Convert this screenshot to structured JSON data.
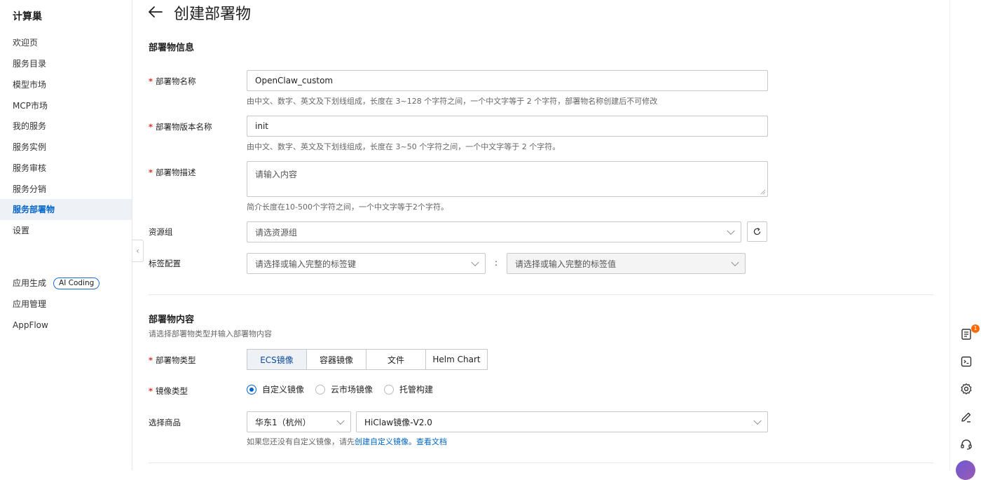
{
  "sidebar": {
    "brand": "计算巢",
    "items": [
      {
        "label": "欢迎页"
      },
      {
        "label": "服务目录"
      },
      {
        "label": "模型市场"
      },
      {
        "label": "MCP市场"
      },
      {
        "label": "我的服务"
      },
      {
        "label": "服务实例"
      },
      {
        "label": "服务审核"
      },
      {
        "label": "服务分销"
      },
      {
        "label": "服务部署物",
        "active": true
      },
      {
        "label": "设置"
      }
    ],
    "bottom_items": [
      {
        "label": "应用生成",
        "badge": "AI Coding"
      },
      {
        "label": "应用管理"
      },
      {
        "label": "AppFlow"
      }
    ]
  },
  "header": {
    "title": "创建部署物"
  },
  "section_info": {
    "title": "部署物信息",
    "name": {
      "label": "部署物名称",
      "value": "OpenClaw_custom",
      "help": "由中文、数字、英文及下划线组成，长度在 3~128 个字符之间，一个中文字等于 2 个字符，部署物名称创建后不可修改"
    },
    "version": {
      "label": "部署物版本名称",
      "value": "init",
      "help": "由中文、数字、英文及下划线组成，长度在 3~50 个字符之间，一个中文字等于 2 个字符。"
    },
    "description": {
      "label": "部署物描述",
      "placeholder": "请输入内容",
      "help": "简介长度在10-500个字符之间，一个中文字等于2个字符。"
    },
    "resource_group": {
      "label": "资源组",
      "placeholder": "请选资源组"
    },
    "tags": {
      "label": "标签配置",
      "key_placeholder": "请选择或输入完整的标签键",
      "separator": ":",
      "value_placeholder": "请选择或输入完整的标签值"
    }
  },
  "section_content": {
    "title": "部署物内容",
    "subtitle": "请选择部署物类型并输入部署物内容",
    "type": {
      "label": "部署物类型",
      "options": [
        "ECS镜像",
        "容器镜像",
        "文件",
        "Helm Chart"
      ],
      "selected": "ECS镜像"
    },
    "image_type": {
      "label": "镜像类型",
      "options": [
        "自定义镜像",
        "云市场镜像",
        "托管构建"
      ],
      "selected": "自定义镜像"
    },
    "product": {
      "label": "选择商品",
      "region": "华东1（杭州）",
      "image": "HiClaw镜像-V2.0",
      "help_prefix": "如果您还没有自定义镜像，请先",
      "help_link1": "创建自定义镜像。",
      "help_link2": "查看文档"
    }
  },
  "right_toolbar": {
    "notification_count": "1",
    "icons": [
      "notes-icon",
      "code-review-icon",
      "settings-icon",
      "edit-icon",
      "headset-icon"
    ]
  },
  "colors": {
    "primary": "#0064c8",
    "required": "#d93026",
    "active_bg": "#eef2f7"
  }
}
